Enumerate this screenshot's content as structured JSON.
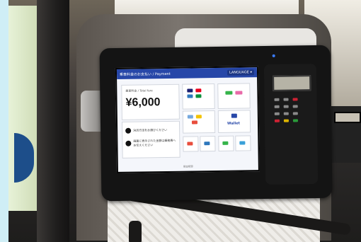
{
  "device": {
    "header_title": "乗車料金のお支払い / Payment",
    "language_button": "LANGUAGE ▾",
    "amount_label": "乗車料金 / Total fare",
    "amount": "¥6,000",
    "note_1": "決済方法をお選びください",
    "note_2": "画面に表示された金額は乗務員へお伝えください",
    "wallet_tile": "Wallet",
    "footer": "現金精算"
  },
  "colors": {
    "screen_header": "#2747a8",
    "screen_background": "#f4f6fb",
    "frame_background": "#cfeef6"
  },
  "icons": [
    "card-brand-icons",
    "qr-code-icon",
    "wallet-icon",
    "keypad-icon"
  ]
}
